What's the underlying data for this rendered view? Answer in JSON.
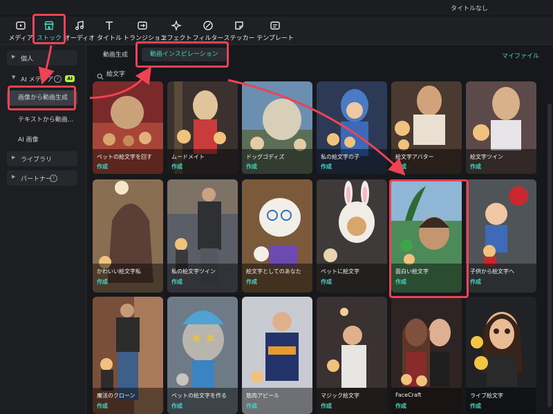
{
  "window": {
    "title": "タイトルなし"
  },
  "toolbar": {
    "items": [
      {
        "label": "メディア",
        "icon": "media-icon"
      },
      {
        "label": "ストック",
        "icon": "stock-icon",
        "active": true
      },
      {
        "label": "オーディオ",
        "icon": "music-note-icon"
      },
      {
        "label": "タイトル",
        "icon": "title-t-icon"
      },
      {
        "label": "トランジション",
        "icon": "transition-icon"
      },
      {
        "label": "エフェクト",
        "icon": "effect-sparkle-icon"
      },
      {
        "label": "フィルター",
        "icon": "filter-icon"
      },
      {
        "label": "ステッカー",
        "icon": "sticker-icon"
      },
      {
        "label": "テンプレート",
        "icon": "template-icon"
      }
    ]
  },
  "sidebar": {
    "personal": "個人",
    "ai_media": "AI メディア",
    "ai_badge": "AI",
    "img_to_video": "画像から動画生成",
    "text_to_video": "テキストから動画...",
    "ai_image": "AI 画像",
    "library": "ライブラリ",
    "partner": "パートナー"
  },
  "tabs": {
    "video_gen": "動画生成",
    "inspiration": "動画インスピレーション",
    "my_files": "マイファイル"
  },
  "search": {
    "value": "絵文字"
  },
  "cards": [
    {
      "title": "ペットの絵文字を回す",
      "action": "作成"
    },
    {
      "title": "ムードメイト",
      "action": "作成"
    },
    {
      "title": "ドッグゴディズ",
      "action": "作成"
    },
    {
      "title": "私の絵文字の子",
      "action": "作成"
    },
    {
      "title": "絵文字アバター",
      "action": "作成"
    },
    {
      "title": "絵文字ツイン",
      "action": "作成"
    },
    {
      "title": "かわいい絵文字私",
      "action": "作成"
    },
    {
      "title": "私の絵文字ツイン",
      "action": "作成"
    },
    {
      "title": "絵文字としてのあなた",
      "action": "作成"
    },
    {
      "title": "ペットに絵文字",
      "action": "作成"
    },
    {
      "title": "面白い絵文字",
      "action": "作成"
    },
    {
      "title": "子供から絵文字へ",
      "action": "作成"
    },
    {
      "title": "魔法のクローン",
      "action": "作成"
    },
    {
      "title": "ペットの絵文字を作る",
      "action": "作成"
    },
    {
      "title": "筋肉アピール",
      "action": "作成"
    },
    {
      "title": "マジック絵文字",
      "action": "作成"
    },
    {
      "title": "FaceCraft",
      "action": "作成"
    },
    {
      "title": "ライブ絵文字",
      "action": "作成"
    }
  ],
  "colors": {
    "accent": "#43d7c4",
    "highlight": "#ef4252",
    "ai_badge": "#b9f23a"
  }
}
